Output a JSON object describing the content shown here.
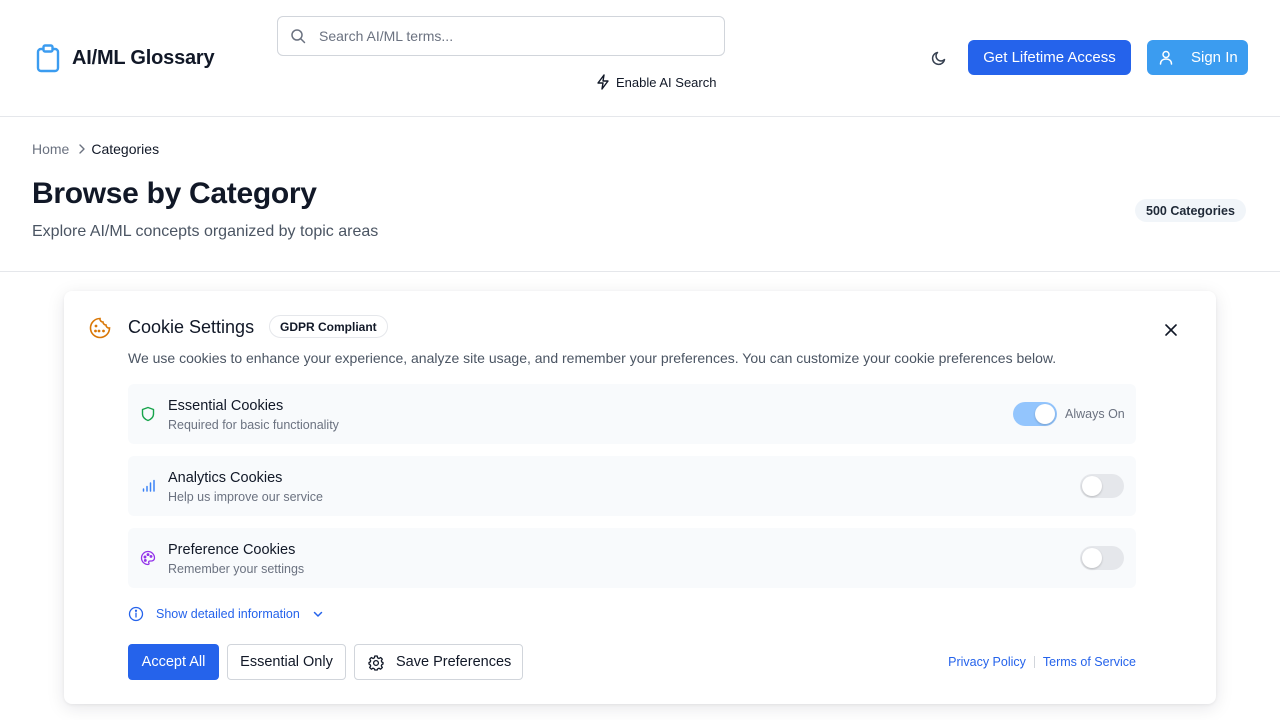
{
  "header": {
    "app_title": "AI/ML Glossary",
    "search_placeholder": "Search AI/ML terms...",
    "ai_search_label": "Enable AI Search",
    "lifetime_label": "Get Lifetime Access",
    "signin_label": "Sign In",
    "accent": "#2563eb"
  },
  "breadcrumb": {
    "home": "Home",
    "current": "Categories"
  },
  "page": {
    "title": "Browse by Category",
    "subtitle": "Explore AI/ML concepts organized by topic areas",
    "count_badge": "500 Categories"
  },
  "cookie_dialog": {
    "title": "Cookie Settings",
    "badge": "GDPR Compliant",
    "description": "We use cookies to enhance your experience, analyze site usage, and remember your preferences. You can customize your cookie preferences below.",
    "categories": [
      {
        "title": "Essential Cookies",
        "subtitle": "Required for basic functionality",
        "enabled": true,
        "status_label": "Always On",
        "icon": "shield-icon"
      },
      {
        "title": "Analytics Cookies",
        "subtitle": "Help us improve our service",
        "enabled": false,
        "icon": "bar-chart-icon"
      },
      {
        "title": "Preference Cookies",
        "subtitle": "Remember your settings",
        "enabled": false,
        "icon": "palette-icon"
      }
    ],
    "details_label": "Show detailed information",
    "accept_all_label": "Accept All",
    "essential_only_label": "Essential Only",
    "save_label": "Save Preferences",
    "privacy_link": "Privacy Policy",
    "terms_link": "Terms of Service"
  }
}
